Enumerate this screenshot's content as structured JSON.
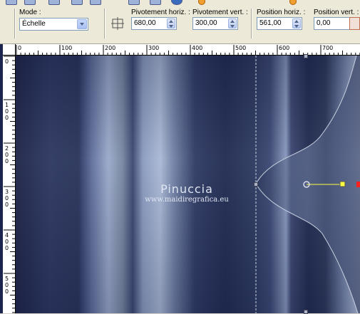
{
  "toolbar": {
    "mode_label": "Mode :",
    "mode_value": "Échelle",
    "pivot_h_label": "Pivotement horiz. :",
    "pivot_h_value": "680,00",
    "pivot_v_label": "Pivotement vert. :",
    "pivot_v_value": "300,00",
    "pos_h_label": "Position horiz. :",
    "pos_h_value": "561,00",
    "pos_v_label": "Position vert. :",
    "pos_v_value": "0,00"
  },
  "ruler_h": [
    "0",
    "100",
    "200",
    "300",
    "400",
    "500",
    "600",
    "700"
  ],
  "ruler_v": [
    "0",
    "100",
    "200",
    "300",
    "400",
    "500"
  ],
  "watermark": {
    "title": "Pinuccia",
    "url": "www.maidiregrafica.eu"
  },
  "colors": {
    "selection_line": "#c8d0e0",
    "handle_line": "#ffff40",
    "node_red": "#ff2020"
  }
}
